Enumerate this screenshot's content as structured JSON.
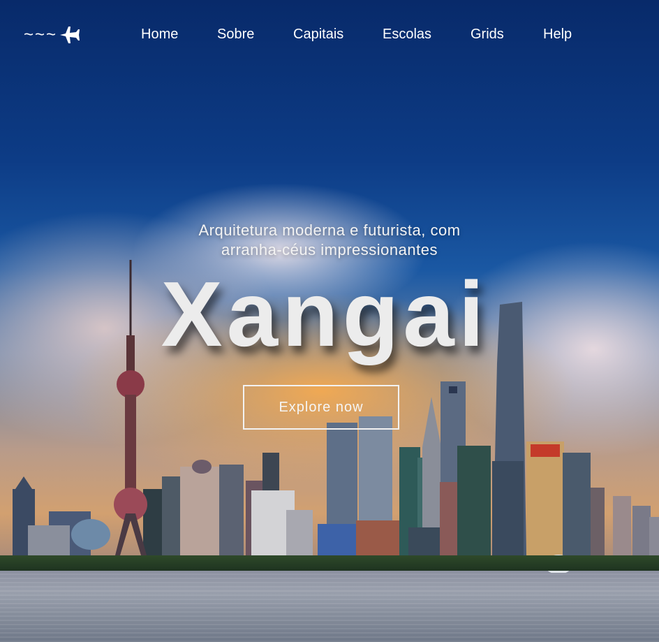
{
  "nav": {
    "logo_text": "~~~",
    "links": [
      "Home",
      "Sobre",
      "Capitais",
      "Escolas",
      "Grids",
      "Help"
    ]
  },
  "hero": {
    "subtitle_line1": "Arquitetura moderna e futurista, com",
    "subtitle_line2": "arranha-céus impressionantes",
    "title": "Xangai",
    "cta_label": "Explore now"
  },
  "colors": {
    "sky_top": "#082a6a",
    "text": "#ffffff",
    "title": "#ececec",
    "cloud_glow": "#f5aa50"
  },
  "icons": {
    "logo": "airplane-icon"
  }
}
